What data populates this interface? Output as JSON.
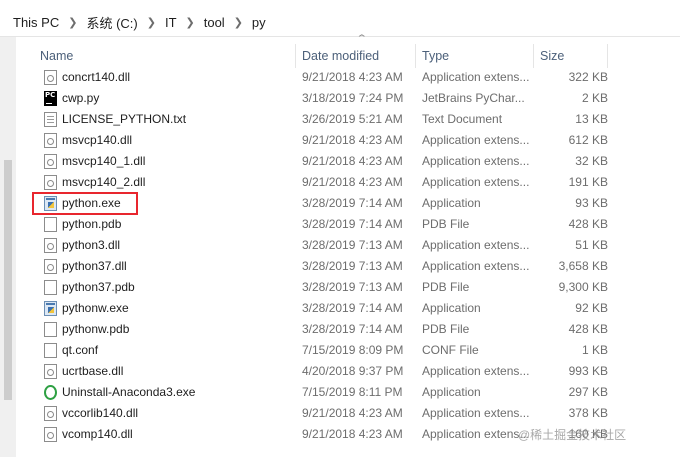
{
  "breadcrumb": {
    "items": [
      "This PC",
      "系统 (C:)",
      "IT",
      "tool",
      "py"
    ]
  },
  "columns": {
    "name": "Name",
    "date_modified": "Date modified",
    "type": "Type",
    "size": "Size"
  },
  "files": [
    {
      "name": "concrt140.dll",
      "date": "9/21/2018 4:23 AM",
      "type": "Application extens...",
      "size": "322 KB",
      "icon": "dll-file-icon"
    },
    {
      "name": "cwp.py",
      "date": "3/18/2019 7:24 PM",
      "type": "JetBrains PyChar...",
      "size": "2 KB",
      "icon": "pycharm-file-icon"
    },
    {
      "name": "LICENSE_PYTHON.txt",
      "date": "3/26/2019 5:21 AM",
      "type": "Text Document",
      "size": "13 KB",
      "icon": "text-file-icon"
    },
    {
      "name": "msvcp140.dll",
      "date": "9/21/2018 4:23 AM",
      "type": "Application extens...",
      "size": "612 KB",
      "icon": "dll-file-icon"
    },
    {
      "name": "msvcp140_1.dll",
      "date": "9/21/2018 4:23 AM",
      "type": "Application extens...",
      "size": "32 KB",
      "icon": "dll-file-icon"
    },
    {
      "name": "msvcp140_2.dll",
      "date": "9/21/2018 4:23 AM",
      "type": "Application extens...",
      "size": "191 KB",
      "icon": "dll-file-icon"
    },
    {
      "name": "python.exe",
      "date": "3/28/2019 7:14 AM",
      "type": "Application",
      "size": "93 KB",
      "icon": "python-app-icon"
    },
    {
      "name": "python.pdb",
      "date": "3/28/2019 7:14 AM",
      "type": "PDB File",
      "size": "428 KB",
      "icon": "blank-file-icon"
    },
    {
      "name": "python3.dll",
      "date": "3/28/2019 7:13 AM",
      "type": "Application extens...",
      "size": "51 KB",
      "icon": "dll-file-icon"
    },
    {
      "name": "python37.dll",
      "date": "3/28/2019 7:13 AM",
      "type": "Application extens...",
      "size": "3,658 KB",
      "icon": "dll-file-icon"
    },
    {
      "name": "python37.pdb",
      "date": "3/28/2019 7:13 AM",
      "type": "PDB File",
      "size": "9,300 KB",
      "icon": "blank-file-icon"
    },
    {
      "name": "pythonw.exe",
      "date": "3/28/2019 7:14 AM",
      "type": "Application",
      "size": "92 KB",
      "icon": "python-app-icon"
    },
    {
      "name": "pythonw.pdb",
      "date": "3/28/2019 7:14 AM",
      "type": "PDB File",
      "size": "428 KB",
      "icon": "blank-file-icon"
    },
    {
      "name": "qt.conf",
      "date": "7/15/2019 8:09 PM",
      "type": "CONF File",
      "size": "1 KB",
      "icon": "blank-file-icon"
    },
    {
      "name": "ucrtbase.dll",
      "date": "4/20/2018 9:37 PM",
      "type": "Application extens...",
      "size": "993 KB",
      "icon": "dll-file-icon"
    },
    {
      "name": "Uninstall-Anaconda3.exe",
      "date": "7/15/2019 8:11 PM",
      "type": "Application",
      "size": "297 KB",
      "icon": "anaconda-uninstall-icon"
    },
    {
      "name": "vccorlib140.dll",
      "date": "9/21/2018 4:23 AM",
      "type": "Application extens...",
      "size": "378 KB",
      "icon": "dll-file-icon"
    },
    {
      "name": "vcomp140.dll",
      "date": "9/21/2018 4:23 AM",
      "type": "Application extens...",
      "size": "160 KB",
      "icon": "dll-file-icon"
    }
  ],
  "highlighted_file": "python.exe",
  "watermark": "@稀土掘金技术社区",
  "colors": {
    "highlight_border": "#e8262e",
    "header_text": "#4c607a"
  }
}
